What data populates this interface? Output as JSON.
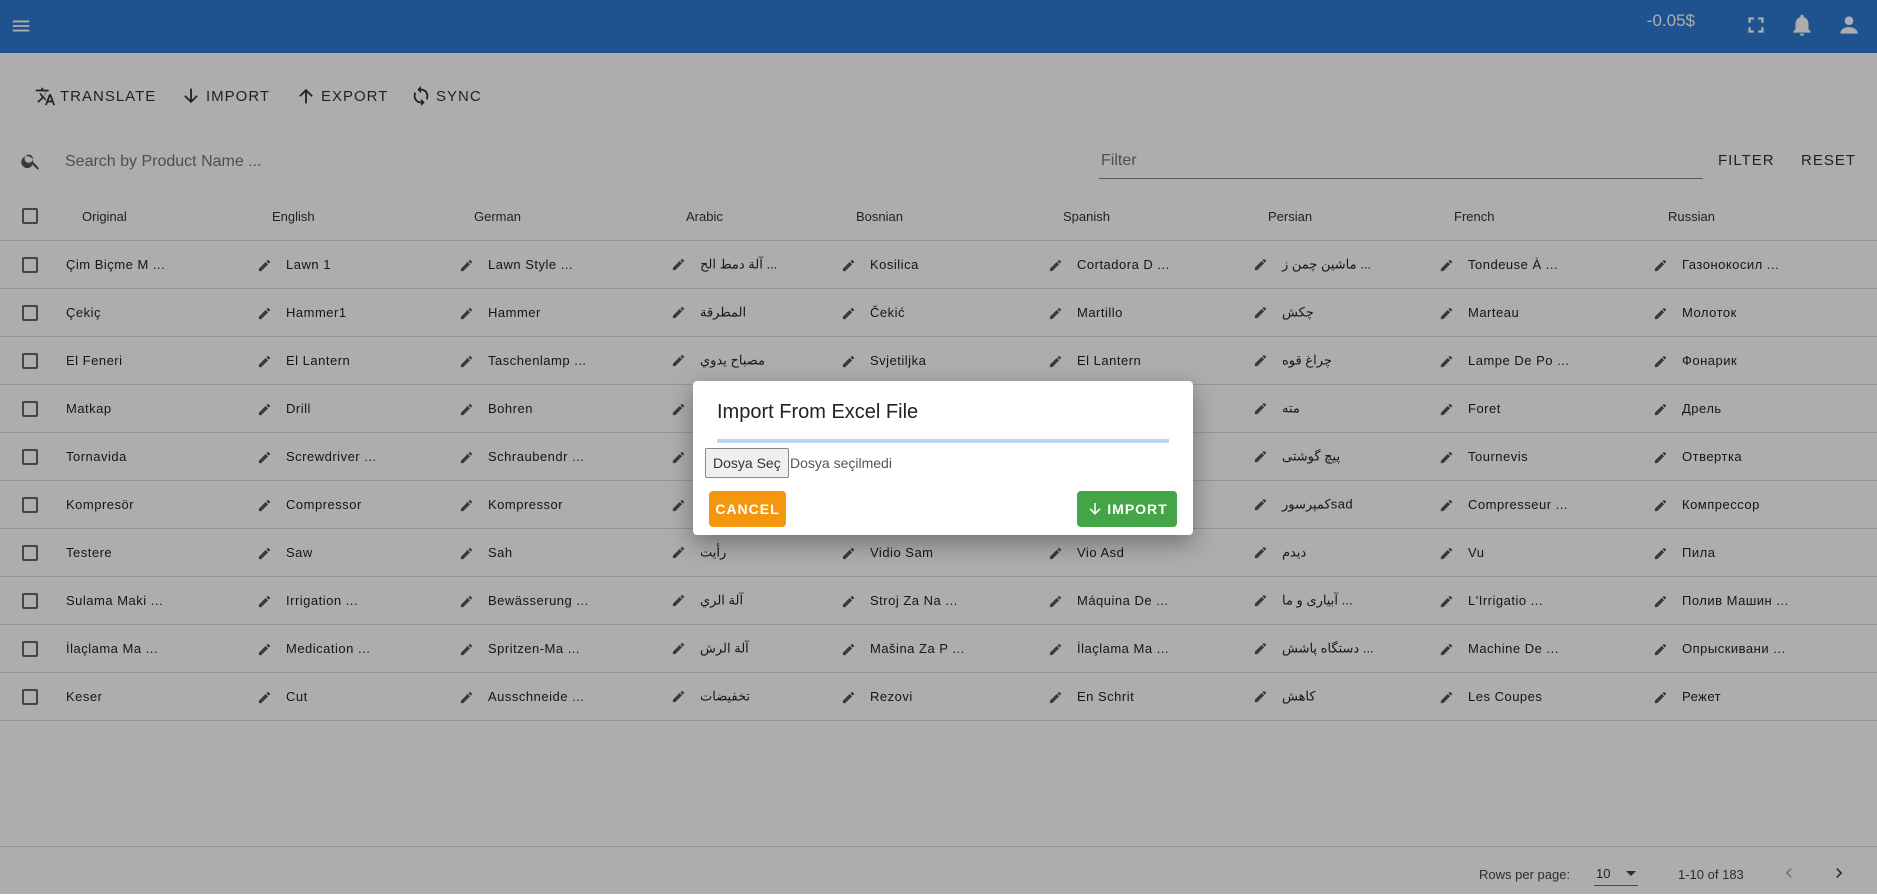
{
  "appbar": {
    "balance": "-0.05$",
    "icons": [
      "menu-icon",
      "fullscreen-icon",
      "bell-icon",
      "account-icon"
    ],
    "color": "#2e7bd3"
  },
  "toolbar": {
    "translate": "TRANSLATE",
    "import": "IMPORT",
    "export": "EXPORT",
    "sync": "SYNC"
  },
  "search": {
    "placeholder": "Search by Product Name ...",
    "filter_placeholder": "Filter",
    "filter_button": "FILTER",
    "reset_button": "RESET"
  },
  "table": {
    "headers": [
      "Original",
      "English",
      "German",
      "Arabic",
      "Bosnian",
      "Spanish",
      "Persian",
      "French",
      "Russian"
    ],
    "rows": [
      [
        "Çim Biçme M ...",
        "Lawn 1",
        "Lawn Style ...",
        "آلة دمط الح ...",
        "Kosilica",
        "Cortadora D ...",
        "ماشین چمن ز ...",
        "Tondeuse À ...",
        "Газонокосил ..."
      ],
      [
        "Çekiç",
        "Hammer1",
        "Hammer",
        "المطرقة",
        "Čekić",
        "Martillo",
        "چکش",
        "Marteau",
        "Молоток"
      ],
      [
        "El Feneri",
        "El Lantern",
        "Taschenlamp ...",
        "مصباح يدوي",
        "Svjetiljka",
        "El Lantern",
        "چراغ قوه",
        "Lampe De Po ...",
        "Фонарик"
      ],
      [
        "Matkap",
        "Drill",
        "Bohren",
        "",
        "",
        "",
        "مته",
        "Foret",
        "Дрель"
      ],
      [
        "Tornavida",
        "Screwdriver ...",
        "Schraubendr ...",
        "",
        "",
        "",
        "پیچ گوشتی",
        "Tournevis",
        "Отвертка"
      ],
      [
        "Kompresör",
        "Compressor",
        "Kompressor",
        "",
        "",
        "",
        "کمپرسورsad",
        "Compresseur ...",
        "Компрессор"
      ],
      [
        "Testere",
        "Saw",
        "Sah",
        "رأيت",
        "Vidio Sam",
        "Vio Asd",
        "دیدم",
        "Vu",
        "Пила"
      ],
      [
        "Sulama Maki ...",
        "Irrigation ...",
        "Bewässerung ...",
        "آلة الري",
        "Stroj Za Na ...",
        "Máquina De ...",
        "آبیاری و ما ...",
        "L'Irrigatio ...",
        "Полив Машин ..."
      ],
      [
        "İlaçlama Ma ...",
        "Medication ...",
        "Spritzen-Ma ...",
        "آلة الرش",
        "Mašina Za P ...",
        "İlaçlama Ma ...",
        "دستگاه پاشش ...",
        "Machine De ...",
        "Опрыскивани ..."
      ],
      [
        "Keser",
        "Cut",
        "Ausschneide ...",
        "تخفيضات",
        "Rezovi",
        "En Schrit",
        "کاهش",
        "Les Coupes",
        "Режет"
      ]
    ]
  },
  "pagination": {
    "rows_per_page_label": "Rows per page:",
    "rows_per_page": "10",
    "range": "1-10 of 183"
  },
  "dialog": {
    "title": "Import From Excel File",
    "file_button": "Dosya Seç",
    "file_status": "Dosya seçilmedi",
    "cancel": "CANCEL",
    "import": "IMPORT",
    "cancel_color": "#f5960f",
    "import_color": "#43a546"
  }
}
